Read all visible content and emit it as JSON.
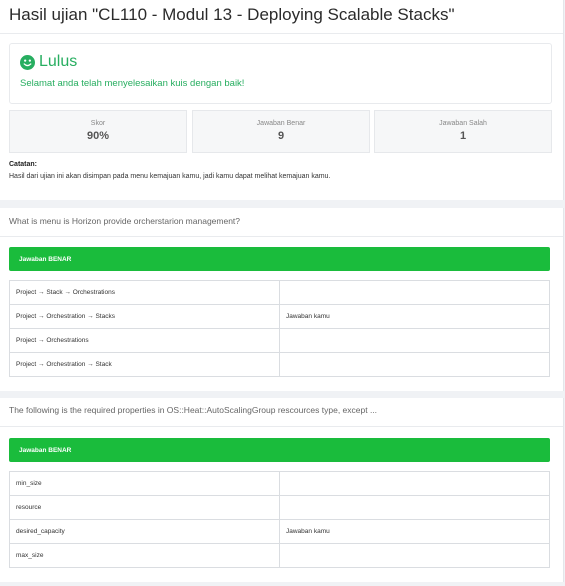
{
  "page": {
    "title": "Hasil ujian \"CL110 - Modul 13 - Deploying Scalable Stacks\""
  },
  "result": {
    "status": "Lulus",
    "icon": "smile-icon",
    "message": "Selamat anda telah menyelesaikan kuis dengan baik!",
    "color": "#27ae60"
  },
  "stats": [
    {
      "label": "Skor",
      "value": "90%"
    },
    {
      "label": "Jawaban Benar",
      "value": "9"
    },
    {
      "label": "Jawaban Salah",
      "value": "1"
    }
  ],
  "notes": {
    "label": "Catatan:",
    "text": "Hasil dari ujian ini akan disimpan pada menu kemajuan kamu, jadi kamu dapat melihat kemajuan kamu."
  },
  "questions": [
    {
      "text": "What is menu is Horizon provide orcherstarion management?",
      "badge": "Jawaban BENAR",
      "options": [
        {
          "text": "Project → Stack → Orchestrations",
          "mark": ""
        },
        {
          "text": "Project → Orchestration → Stacks",
          "mark": "Jawaban kamu"
        },
        {
          "text": "Project → Orchestrations",
          "mark": ""
        },
        {
          "text": "Project → Orchestration → Stack",
          "mark": ""
        }
      ]
    },
    {
      "text": "The following is the required properties in OS::Heat::AutoScalingGroup rescources type, except ...",
      "badge": "Jawaban BENAR",
      "options": [
        {
          "text": "min_size",
          "mark": ""
        },
        {
          "text": "resource",
          "mark": ""
        },
        {
          "text": "desired_capacity",
          "mark": "Jawaban kamu"
        },
        {
          "text": "max_size",
          "mark": ""
        }
      ]
    }
  ],
  "colors": {
    "correct": "#1abc3c",
    "background": "#f0f2f5"
  }
}
